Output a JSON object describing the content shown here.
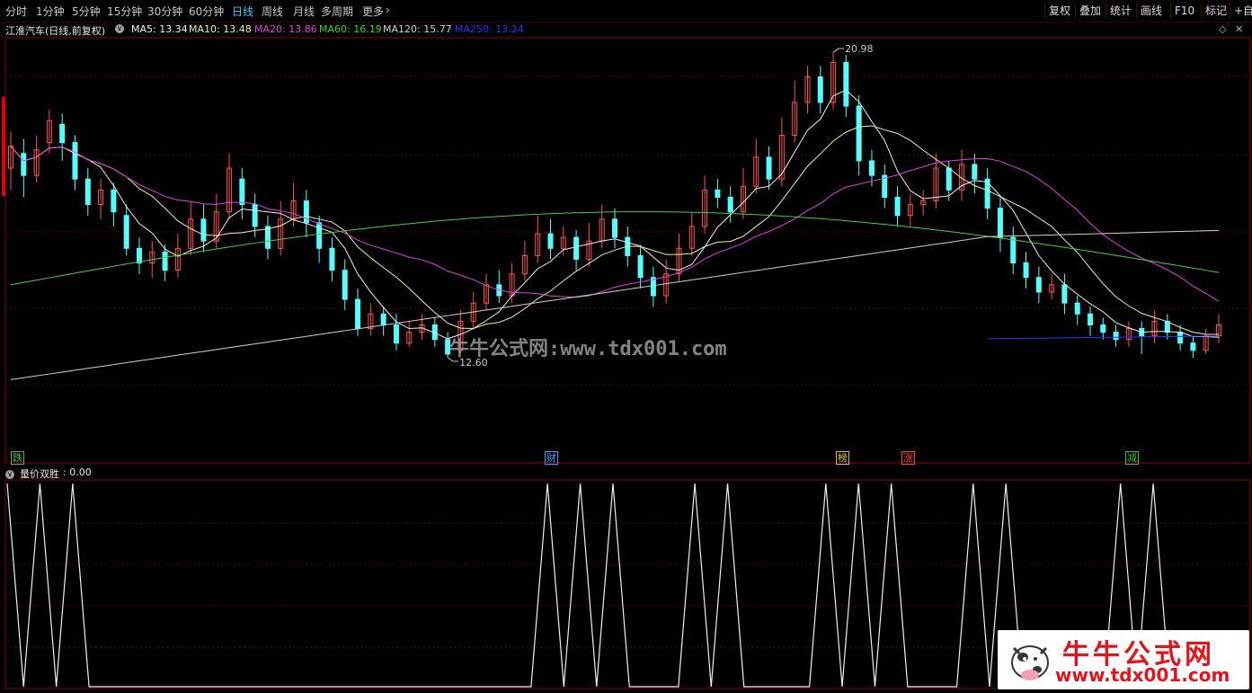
{
  "toolbar": {
    "periods": [
      "分时",
      "1分钟",
      "5分钟",
      "15分钟",
      "30分钟",
      "60分钟",
      "日线",
      "周线",
      "月线",
      "多周期",
      "更多"
    ],
    "active_period": "日线",
    "right_buttons": [
      "复权",
      "叠加",
      "统计",
      "画线",
      "F10",
      "标记",
      "+自"
    ]
  },
  "main_panel": {
    "title": "江淮汽车(日线,前复权)",
    "ma": [
      {
        "label": "MA5: 13.34",
        "color": "#f0f0f0"
      },
      {
        "label": "MA10: 13.48",
        "color": "#f0f0a0"
      },
      {
        "label": "MA20: 13.86",
        "color": "#e040e0"
      },
      {
        "label": "MA60: 16.19",
        "color": "#40d040"
      },
      {
        "label": "MA120: 15.77",
        "color": "#d0d0d0"
      },
      {
        "label": "MA250: 13.24",
        "color": "#3030ff"
      }
    ],
    "high_label": "20.98",
    "low_label": "12.60",
    "signals": [
      {
        "text": "跌",
        "color": "#40c040"
      },
      {
        "text": "财",
        "color": "#40a0ff"
      },
      {
        "text": "榜",
        "color": "#e0c040"
      },
      {
        "text": "涨",
        "color": "#ff4040"
      },
      {
        "text": "减",
        "color": "#40c040"
      }
    ],
    "watermark": "牛牛公式网:www.tdx001.com"
  },
  "indicator_panel": {
    "title": "量价双胜",
    "value": ": 0.00",
    "ticks": [
      1,
      0,
      1,
      0,
      1,
      0,
      0,
      0,
      0,
      0,
      0,
      0,
      0,
      0,
      0,
      0,
      0,
      0,
      0,
      0,
      0,
      0,
      0,
      0,
      0,
      0,
      0,
      0,
      0,
      0,
      0,
      0,
      0,
      1,
      0,
      1,
      0,
      1,
      0,
      0,
      0,
      0,
      1,
      0,
      1,
      0,
      0,
      0,
      0,
      0,
      1,
      0,
      1,
      0,
      1,
      0,
      0,
      0,
      0,
      1,
      0,
      1,
      0,
      0,
      0,
      0,
      0,
      0,
      1,
      0,
      1,
      0,
      0,
      0,
      0
    ]
  },
  "logo": {
    "title": "牛牛公式网",
    "url": "www.tdx001.com"
  },
  "colors": {
    "up": "#ff5050",
    "down": "#54ffff",
    "grid": "#6a0000",
    "border": "#900000"
  }
}
